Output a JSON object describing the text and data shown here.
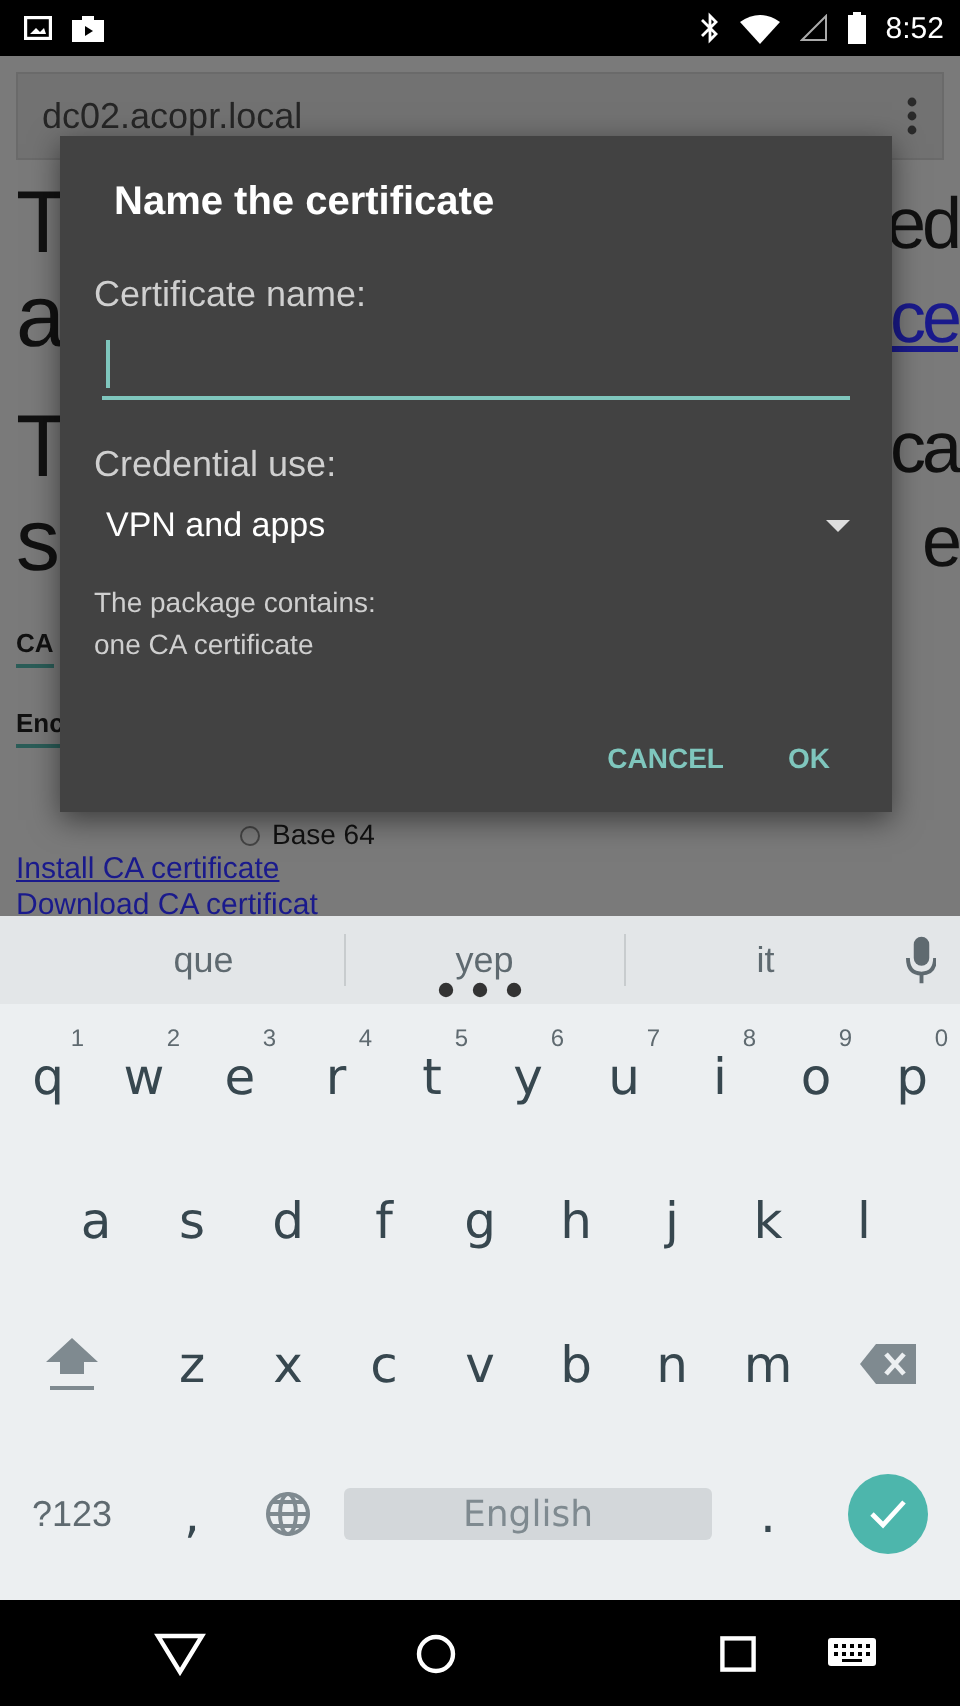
{
  "status_bar": {
    "time": "8:52"
  },
  "browser": {
    "url": "dc02.acopr.local",
    "paragraphs": [
      [
        {
          "left": "T",
          "right": "ed",
          "right_link": false
        },
        {
          "left": "a",
          "right": "ce",
          "right_link": true
        }
      ],
      [
        {
          "left": "T",
          "right": "ca",
          "right_link": false
        },
        {
          "left": "s",
          "right": "e",
          "right_link": false
        }
      ]
    ],
    "sections": [
      "CA",
      "Enc"
    ],
    "radio_option": {
      "label": "Base 64",
      "selected": false
    },
    "links": [
      "Install CA certificate",
      "Download CA certificat"
    ]
  },
  "dialog": {
    "title": "Name the certificate",
    "name_field": {
      "label": "Certificate name:",
      "focused": true
    },
    "credential_use": {
      "label": "Credential use:",
      "value": "VPN and apps"
    },
    "info_lines": [
      "The package contains:",
      "one CA certificate"
    ],
    "buttons": [
      "CANCEL",
      "OK"
    ]
  },
  "keyboard": {
    "suggestions": [
      "que",
      "yep",
      "it"
    ],
    "rows": [
      [
        {
          "kind": "letter",
          "key": "q",
          "hint": "1"
        },
        {
          "kind": "letter",
          "key": "w",
          "hint": "2"
        },
        {
          "kind": "letter",
          "key": "e",
          "hint": "3"
        },
        {
          "kind": "letter",
          "key": "r",
          "hint": "4"
        },
        {
          "kind": "letter",
          "key": "t",
          "hint": "5"
        },
        {
          "kind": "letter",
          "key": "y",
          "hint": "6"
        },
        {
          "kind": "letter",
          "key": "u",
          "hint": "7"
        },
        {
          "kind": "letter",
          "key": "i",
          "hint": "8"
        },
        {
          "kind": "letter",
          "key": "o",
          "hint": "9"
        },
        {
          "kind": "letter",
          "key": "p",
          "hint": "0"
        }
      ],
      [
        {
          "kind": "letter",
          "key": "a"
        },
        {
          "kind": "letter",
          "key": "s"
        },
        {
          "kind": "letter",
          "key": "d"
        },
        {
          "kind": "letter",
          "key": "f"
        },
        {
          "kind": "letter",
          "key": "g"
        },
        {
          "kind": "letter",
          "key": "h"
        },
        {
          "kind": "letter",
          "key": "j"
        },
        {
          "kind": "letter",
          "key": "k"
        },
        {
          "kind": "letter",
          "key": "l"
        }
      ],
      [
        {
          "kind": "shift"
        },
        {
          "kind": "letter",
          "key": "z"
        },
        {
          "kind": "letter",
          "key": "x"
        },
        {
          "kind": "letter",
          "key": "c"
        },
        {
          "kind": "letter",
          "key": "v"
        },
        {
          "kind": "letter",
          "key": "b"
        },
        {
          "kind": "letter",
          "key": "n"
        },
        {
          "kind": "letter",
          "key": "m"
        },
        {
          "kind": "backspace"
        }
      ]
    ],
    "bottom_row": {
      "symbols_key": "?123",
      "comma_key": ",",
      "space_key": "English",
      "period_key": "."
    }
  }
}
